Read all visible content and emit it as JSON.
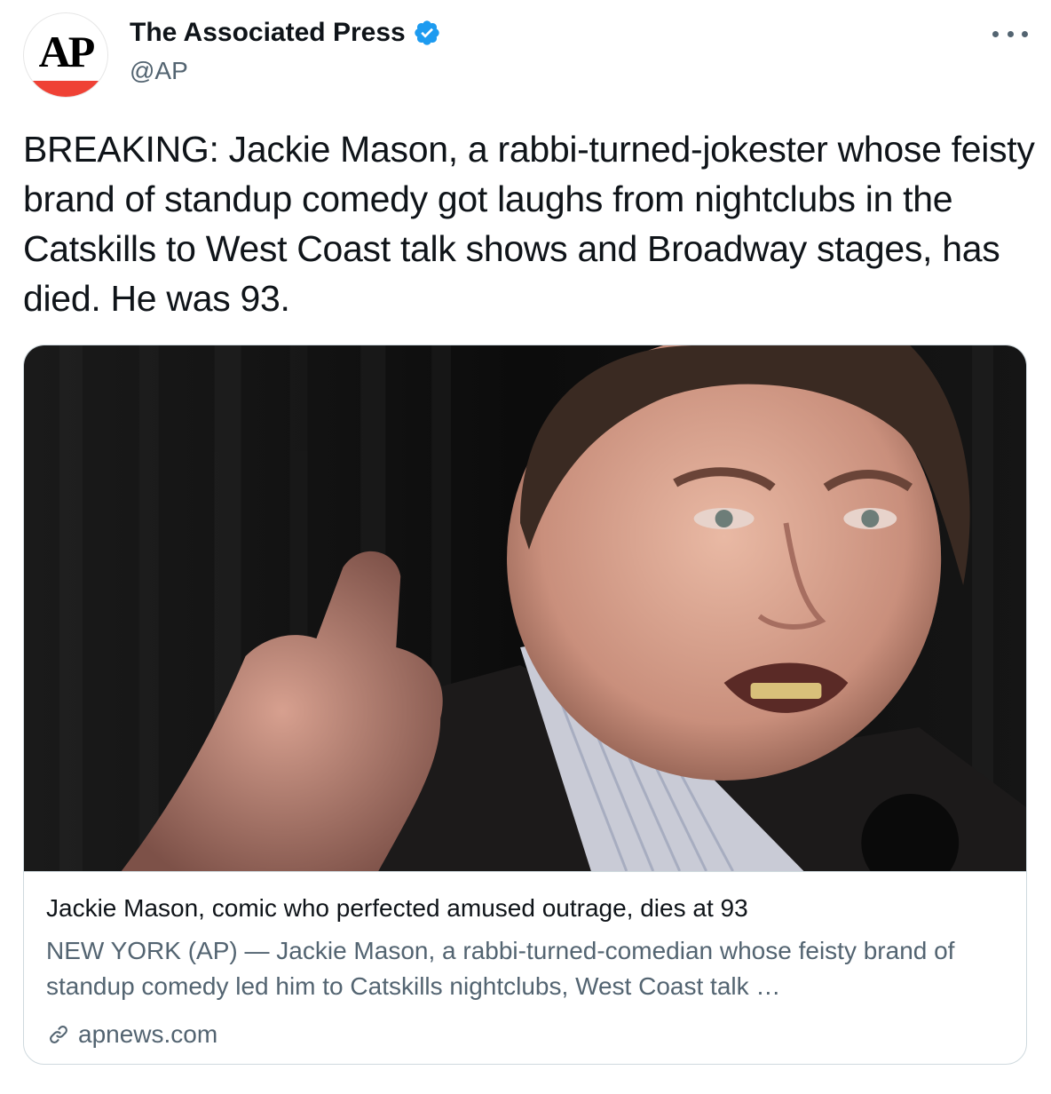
{
  "author": {
    "avatar_text": "AP",
    "display_name": "The Associated Press",
    "handle": "@AP",
    "verified": true
  },
  "tweet": {
    "text": "BREAKING: Jackie Mason, a rabbi-turned-jokester whose feisty brand of standup comedy got laughs from nightclubs in the Catskills to West Coast talk shows and Broadway stages, has died. He was 93."
  },
  "card": {
    "title": "Jackie Mason, comic who perfected amused outrage, dies at 93",
    "description": "NEW YORK (AP) — Jackie Mason, a rabbi-turned-comedian whose feisty brand of standup comedy led him to Catskills nightclubs, West Coast talk …",
    "domain": "apnews.com"
  },
  "colors": {
    "accent_blue": "#1d9bf0",
    "ap_red": "#ef4135",
    "secondary_text": "#536471",
    "border": "#cfd9de"
  },
  "icons": [
    "verified-badge-icon",
    "more-options-icon",
    "link-icon"
  ]
}
